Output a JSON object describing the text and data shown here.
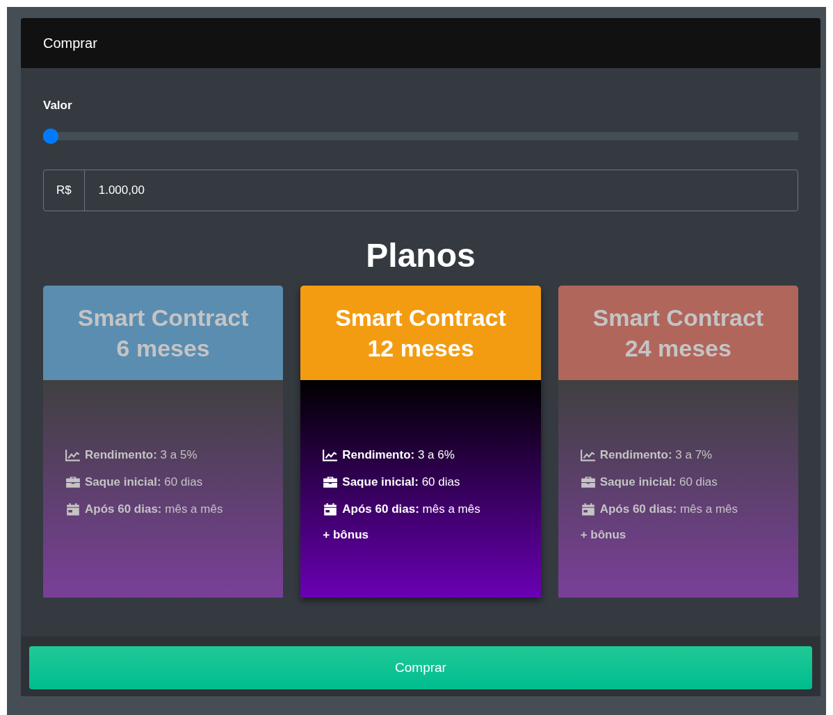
{
  "modal": {
    "title": "Comprar"
  },
  "valor": {
    "label": "Valor",
    "level": 0,
    "prefix": "R$",
    "value": "1.000,00"
  },
  "plans_title": "Planos",
  "plans": [
    {
      "title": "Smart Contract",
      "subtitle": "6 meses",
      "color": "#5b8db0",
      "selected": false,
      "features": [
        {
          "kind": "chart",
          "label": "Rendimento:",
          "value": "3 a 5%"
        },
        {
          "kind": "briefcase",
          "label": "Saque inicial:",
          "value": "60 dias"
        },
        {
          "kind": "calendar",
          "label": "Após 60 dias:",
          "value": "mês a mês"
        }
      ]
    },
    {
      "title": "Smart Contract",
      "subtitle": "12 meses",
      "color": "#f39c12",
      "selected": true,
      "features": [
        {
          "kind": "chart",
          "label": "Rendimento:",
          "value": "3 a 6%"
        },
        {
          "kind": "briefcase",
          "label": "Saque inicial:",
          "value": "60 dias"
        },
        {
          "kind": "calendar",
          "label": "Após 60 dias:",
          "value": "mês a mês"
        }
      ],
      "bonus": "+ bônus"
    },
    {
      "title": "Smart Contract",
      "subtitle": "24 meses",
      "color": "#b1665c",
      "selected": false,
      "features": [
        {
          "kind": "chart",
          "label": "Rendimento:",
          "value": "3 a 7%"
        },
        {
          "kind": "briefcase",
          "label": "Saque inicial:",
          "value": "60 dias"
        },
        {
          "kind": "calendar",
          "label": "Após 60 dias:",
          "value": "mês a mês"
        }
      ],
      "bonus": "+ bônus"
    }
  ],
  "button": "Comprar"
}
